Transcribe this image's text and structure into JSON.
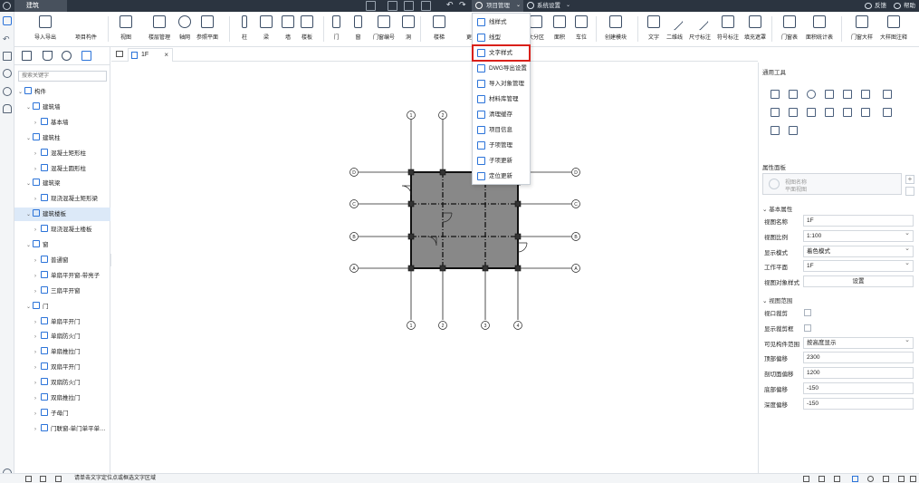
{
  "titlebar": {
    "app_tab": "建筑",
    "project_menu": "项目管理",
    "system_menu": "系统设置",
    "feedback": "反馈",
    "help": "帮助"
  },
  "toolbar": [
    {
      "label": "导入导出"
    },
    {
      "label": "项目构件"
    },
    {
      "label": "视图"
    },
    {
      "label": "楼层管理"
    },
    {
      "label": "轴网"
    },
    {
      "label": "参照平面"
    },
    {
      "label": "柱"
    },
    {
      "label": "梁"
    },
    {
      "label": "墙"
    },
    {
      "label": "楼板"
    },
    {
      "label": "门"
    },
    {
      "label": "窗"
    },
    {
      "label": "门窗编号"
    },
    {
      "label": "洞"
    },
    {
      "label": "楼梯"
    },
    {
      "label": "更"
    },
    {
      "label": "大分区"
    },
    {
      "label": "面积"
    },
    {
      "label": "车位"
    },
    {
      "label": "创建模块"
    },
    {
      "label": "文字"
    },
    {
      "label": "二维线"
    },
    {
      "label": "尺寸标注"
    },
    {
      "label": "符号标注"
    },
    {
      "label": "填充遮罩"
    },
    {
      "label": "门窗表"
    },
    {
      "label": "面积统计表"
    },
    {
      "label": "门窗大样"
    },
    {
      "label": "大样图注释"
    }
  ],
  "dropdown": {
    "items": [
      {
        "label": "线样式"
      },
      {
        "label": "线型"
      },
      {
        "label": "文字样式"
      },
      {
        "label": "DWG导出设置"
      },
      {
        "label": "导入对象管理"
      },
      {
        "label": "材料库管理"
      },
      {
        "label": "清理缓存"
      },
      {
        "label": "项目信息"
      },
      {
        "label": "子项管理"
      },
      {
        "label": "子项更新"
      },
      {
        "label": "定位更新"
      }
    ],
    "highlighted": "文字样式"
  },
  "left_panel": {
    "search_placeholder": "搜索关键字",
    "tree": [
      {
        "label": "构件",
        "level": 0
      },
      {
        "label": "建筑墙",
        "level": 1
      },
      {
        "label": "基本墙",
        "level": 2
      },
      {
        "label": "建筑柱",
        "level": 1
      },
      {
        "label": "混凝土矩形柱",
        "level": 2
      },
      {
        "label": "混凝土圆形柱",
        "level": 2
      },
      {
        "label": "建筑梁",
        "level": 1
      },
      {
        "label": "现浇混凝土矩形梁",
        "level": 2
      },
      {
        "label": "建筑楼板",
        "level": 1,
        "selected": true
      },
      {
        "label": "现浇混凝土楼板",
        "level": 2
      },
      {
        "label": "窗",
        "level": 1
      },
      {
        "label": "普通窗",
        "level": 2
      },
      {
        "label": "单扇平开窗-带亮子",
        "level": 2
      },
      {
        "label": "三扇平开窗",
        "level": 2
      },
      {
        "label": "门",
        "level": 1
      },
      {
        "label": "单扇平开门",
        "level": 2
      },
      {
        "label": "单扇防火门",
        "level": 2
      },
      {
        "label": "单扇推拉门",
        "level": 2
      },
      {
        "label": "双扇平开门",
        "level": 2
      },
      {
        "label": "双扇防火门",
        "level": 2
      },
      {
        "label": "双扇推拉门",
        "level": 2
      },
      {
        "label": "子母门",
        "level": 2
      },
      {
        "label": "门联窗-单门单平单…",
        "level": 2
      }
    ]
  },
  "canvas": {
    "tab_label": "1F",
    "grid_top": [
      "1",
      "2"
    ],
    "grid_bottom": [
      "1",
      "2",
      "3",
      "4"
    ],
    "grid_left": [
      "D",
      "C",
      "B",
      "A"
    ],
    "grid_right": [
      "D",
      "C",
      "B",
      "A"
    ]
  },
  "right_panel": {
    "common_tools_title": "通用工具",
    "properties_title": "属性面板",
    "view_name_placeholder": "视图名称",
    "view_name_sub": "平面视图",
    "basic_section": "基本属性",
    "props": [
      {
        "label": "视图名称",
        "value": "1F",
        "type": "text"
      },
      {
        "label": "视图比例",
        "value": "1:100",
        "type": "select"
      },
      {
        "label": "显示模式",
        "value": "着色模式",
        "type": "select"
      },
      {
        "label": "工作平面",
        "value": "1F",
        "type": "select"
      },
      {
        "label": "视图对象样式",
        "value": "设置",
        "type": "button"
      }
    ],
    "range_section": "视图范围",
    "range_props": [
      {
        "label": "视口裁剪",
        "type": "checkbox"
      },
      {
        "label": "显示裁剪框",
        "type": "checkbox"
      },
      {
        "label": "可见构件范围",
        "value": "按高度显示",
        "type": "select"
      },
      {
        "label": "顶部偏移",
        "value": "2300",
        "type": "text"
      },
      {
        "label": "剖切面偏移",
        "value": "1200",
        "type": "text"
      },
      {
        "label": "底部偏移",
        "value": "-150",
        "type": "text"
      },
      {
        "label": "深度偏移",
        "value": "-150",
        "type": "text"
      }
    ]
  },
  "status": {
    "message": "请单击文字定位点或框选文字区域"
  },
  "colors": {
    "titlebar": "#2b3440",
    "accent": "#2b73d9",
    "highlight_box": "#d9201a",
    "slab_fill": "#888888"
  }
}
